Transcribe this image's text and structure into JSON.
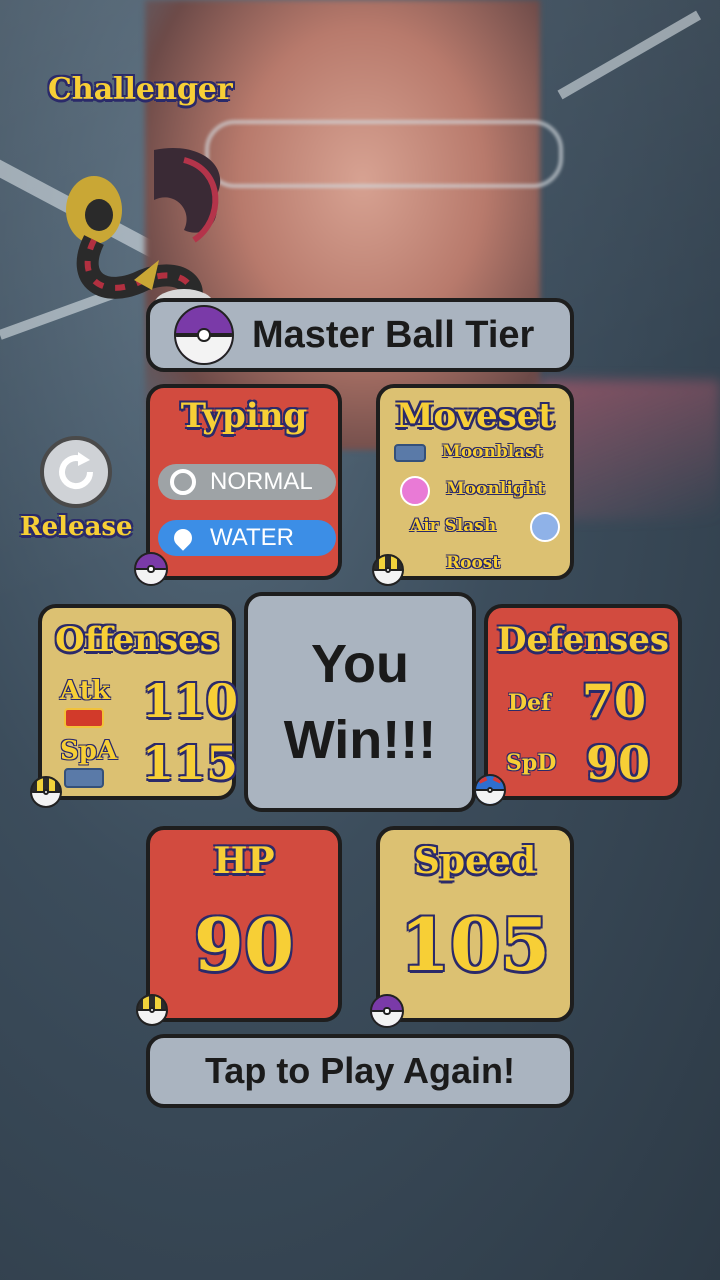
{
  "header": {
    "challenger_label": "Challenger"
  },
  "tier": {
    "label": "Master Ball Tier",
    "ball": "master-ball"
  },
  "typing": {
    "title": "Typing",
    "types": [
      {
        "name": "NORMAL",
        "color": "#9ea3a6",
        "icon": "normal-type-icon"
      },
      {
        "name": "WATER",
        "color": "#3c8ee6",
        "icon": "water-drop-icon"
      }
    ]
  },
  "moveset": {
    "title": "Moveset",
    "moves": [
      "Moonblast",
      "Moonlight",
      "Air Slash",
      "Roost"
    ]
  },
  "offenses": {
    "title": "Offenses",
    "atk_label": "Atk",
    "atk_value": "110",
    "spa_label": "SpA",
    "spa_value": "115"
  },
  "result": {
    "line1": "You",
    "line2": "Win!!!"
  },
  "defenses": {
    "title": "Defenses",
    "def_label": "Def",
    "def_value": "70",
    "spd_label": "SpD",
    "spd_value": "90"
  },
  "hp": {
    "title": "HP",
    "value": "90"
  },
  "speed": {
    "title": "Speed",
    "value": "105"
  },
  "release": {
    "label": "Release"
  },
  "play_again": {
    "label": "Tap to Play Again!"
  },
  "colors": {
    "red_box": "#d24b3f",
    "gold_box": "#dcc172",
    "grey_box": "#aab4c0",
    "title_yellow": "#f7cf36"
  }
}
